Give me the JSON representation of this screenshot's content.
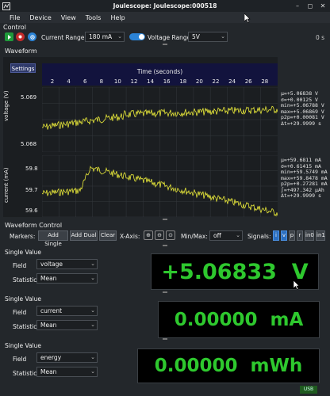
{
  "window": {
    "title": "Joulescope: Joulescope:000518",
    "minimize_glyph": "–",
    "maximize_glyph": "◻",
    "close_glyph": "✕"
  },
  "menu": [
    "File",
    "Device",
    "View",
    "Tools",
    "Help"
  ],
  "control": {
    "label": "Control",
    "current_range_label": "Current Range",
    "current_range_value": "180 mA",
    "voltage_range_label": "Voltage Range",
    "voltage_range_value": "5V",
    "elapsed": "0 s"
  },
  "waveform": {
    "label": "Waveform",
    "settings_label": "Settings",
    "x_axis_title": "Time (seconds)",
    "x_ticks": [
      "2",
      "4",
      "6",
      "8",
      "10",
      "12",
      "14",
      "16",
      "18",
      "20",
      "22",
      "24",
      "26",
      "28"
    ],
    "voltage": {
      "axis_label": "voltage (V)",
      "ticks": [
        "5.069",
        "5.068"
      ],
      "stats": [
        "μ=+5.06838  V",
        "σ=+0.00125  V",
        "min=+5.06788  V",
        "max=+5.06869  V",
        "p2p=+0.00081  V",
        "Δt=+29.9999  s"
      ]
    },
    "current": {
      "axis_label": "current (mA)",
      "ticks": [
        "59.8",
        "59.7",
        "59.6"
      ],
      "stats": [
        "μ=+59.6811  mA",
        "σ=+0.61415  mA",
        "min=+59.5749  mA",
        "max=+59.8478  mA",
        "p2p=+0.27281  mA",
        "∫=+497.342  μAh",
        "Δt=+29.9999  s"
      ]
    },
    "trace_color": "#e8e83a"
  },
  "waveform_control": {
    "label": "Waveform Control",
    "markers_label": "Markers:",
    "add_single": "Add Single",
    "add_dual": "Add Dual",
    "clear": "Clear",
    "x_axis_label": "X-Axis:",
    "minmax_label": "Min/Max:",
    "minmax_value": "off",
    "signals_label": "Signals:",
    "signals": [
      {
        "name": "i",
        "on": true
      },
      {
        "name": "v",
        "on": true
      },
      {
        "name": "p",
        "on": false
      },
      {
        "name": "r",
        "on": false
      },
      {
        "name": "in0",
        "on": false
      },
      {
        "name": "in1",
        "on": false
      }
    ]
  },
  "single_values": [
    {
      "label": "Single Value",
      "field_label": "Field",
      "field": "voltage",
      "statistic_label": "Statistic",
      "statistic": "Mean",
      "display": "+5.06833  V"
    },
    {
      "label": "Single Value",
      "field_label": "Field",
      "field": "current",
      "statistic_label": "Statistic",
      "statistic": "Mean",
      "display": "0.00000  mA"
    },
    {
      "label": "Single Value",
      "field_label": "Field",
      "field": "energy",
      "statistic_label": "Statistic",
      "statistic": "Mean",
      "display": "0.00000  mWh"
    }
  ],
  "status": {
    "usb": "USB"
  },
  "colors": {
    "accent": "#2b83d6",
    "display_green": "#2ec82e",
    "trace": "#e8e83a"
  }
}
